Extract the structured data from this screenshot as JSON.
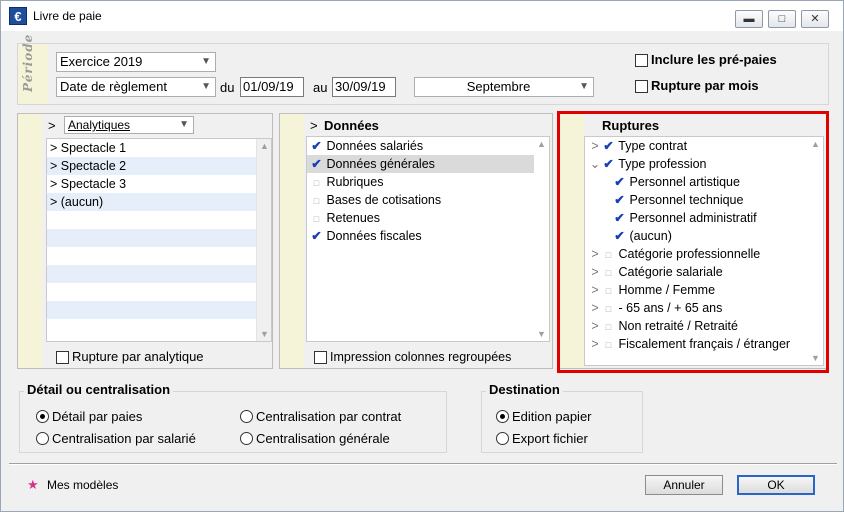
{
  "window": {
    "title": "Livre de paie",
    "icon_char": "€",
    "controls": {
      "minimize": "▬",
      "maximize": "□",
      "close": "✕"
    }
  },
  "periode": {
    "label": "Période",
    "exercice": "Exercice 2019",
    "date_type": "Date de règlement",
    "du_label": "du",
    "du_value": "01/09/19",
    "au_label": "au",
    "au_value": "30/09/19",
    "month": "Septembre",
    "include_prepaies": "Inclure les pré-paies",
    "rupture_mois": "Rupture par mois"
  },
  "analytique": {
    "expander": ">",
    "select": "Analytiques",
    "items": [
      "> Spectacle 1",
      "> Spectacle 2",
      "> Spectacle 3",
      "> (aucun)"
    ],
    "rupture_label": "Rupture par analytique"
  },
  "donnees": {
    "expander": ">",
    "title": "Données",
    "items": [
      {
        "label": "Données salariés",
        "checked": true
      },
      {
        "label": "Données générales",
        "checked": true
      },
      {
        "label": "Rubriques",
        "checked": false
      },
      {
        "label": "Bases de cotisations",
        "checked": false
      },
      {
        "label": "Retenues",
        "checked": false
      },
      {
        "label": "Données fiscales",
        "checked": true
      }
    ],
    "impression_label": "Impression colonnes regroupées"
  },
  "ruptures": {
    "title": "Ruptures",
    "items": [
      {
        "label": "Type contrat",
        "checked": true,
        "expand": ">",
        "level": 0
      },
      {
        "label": "Type profession",
        "checked": true,
        "expand": "⌄",
        "level": 0
      },
      {
        "label": "Personnel artistique",
        "checked": true,
        "expand": "",
        "level": 1
      },
      {
        "label": "Personnel technique",
        "checked": true,
        "expand": "",
        "level": 1
      },
      {
        "label": "Personnel administratif",
        "checked": true,
        "expand": "",
        "level": 1
      },
      {
        "label": "(aucun)",
        "checked": true,
        "expand": "",
        "level": 1
      },
      {
        "label": "Catégorie professionnelle",
        "checked": false,
        "expand": ">",
        "level": 0
      },
      {
        "label": "Catégorie salariale",
        "checked": false,
        "expand": ">",
        "level": 0
      },
      {
        "label": "Homme / Femme",
        "checked": false,
        "expand": ">",
        "level": 0
      },
      {
        "label": "- 65 ans / + 65 ans",
        "checked": false,
        "expand": ">",
        "level": 0
      },
      {
        "label": "Non retraité / Retraité",
        "checked": false,
        "expand": ">",
        "level": 0
      },
      {
        "label": "Fiscalement français / étranger",
        "checked": false,
        "expand": ">",
        "level": 0
      }
    ]
  },
  "detail": {
    "title": "Détail ou centralisation",
    "options": [
      {
        "label": "Détail par paies",
        "selected": true
      },
      {
        "label": "Centralisation par contrat",
        "selected": false
      },
      {
        "label": "Centralisation par salarié",
        "selected": false
      },
      {
        "label": "Centralisation générale",
        "selected": false
      }
    ]
  },
  "destination": {
    "title": "Destination",
    "options": [
      {
        "label": "Edition papier",
        "selected": true
      },
      {
        "label": "Export fichier",
        "selected": false
      }
    ]
  },
  "footer": {
    "models": "Mes modèles",
    "annuler": "Annuler",
    "ok": "OK"
  },
  "colors": {
    "highlight_frame": "#e00000",
    "check": "#1a3fb5",
    "alt_row": "#e6eef9"
  }
}
